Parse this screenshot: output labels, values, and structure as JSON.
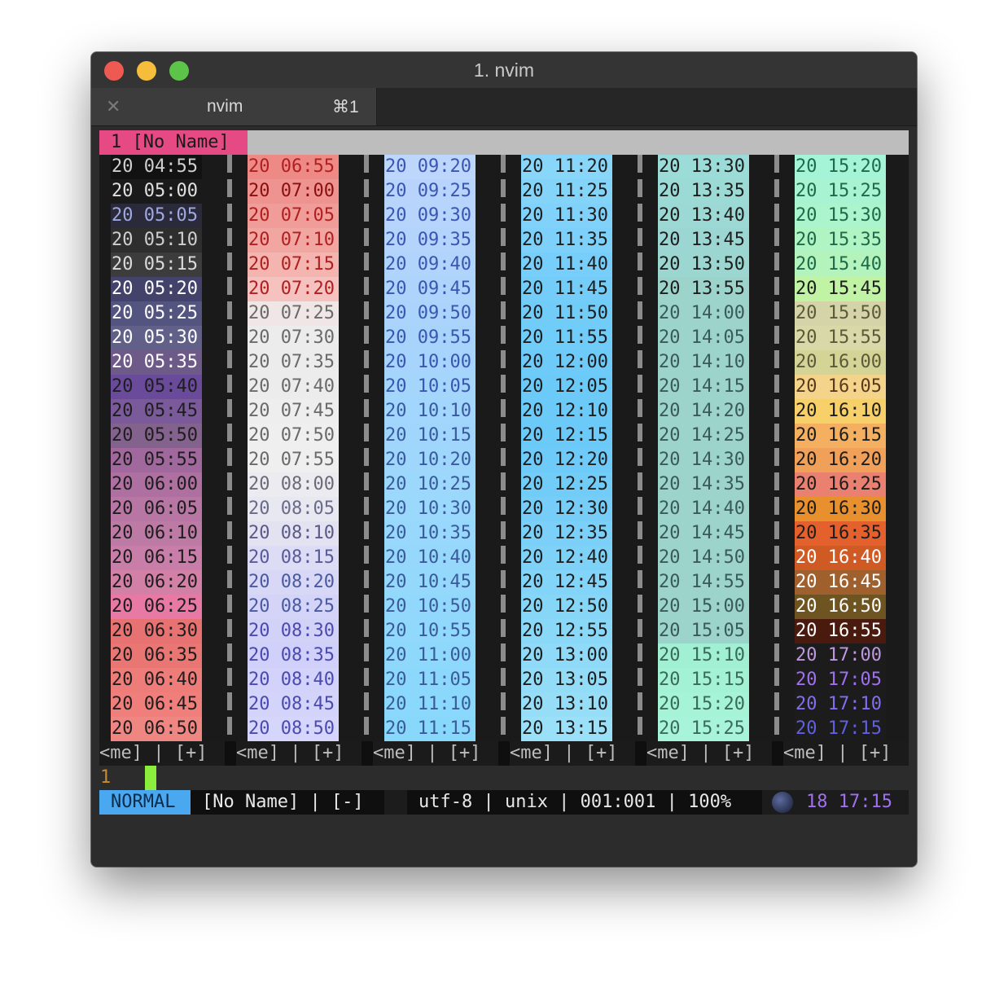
{
  "window": {
    "title": "1. nvim"
  },
  "tab": {
    "name": "nvim",
    "shortcut": "⌘1"
  },
  "tabline": {
    "current": "1 [No Name]"
  },
  "columns": [
    {
      "times": [
        "20 04:55",
        "20 05:00",
        "20 05:05",
        "20 05:10",
        "20 05:15",
        "20 05:20",
        "20 05:25",
        "20 05:30",
        "20 05:35",
        "20 05:40",
        "20 05:45",
        "20 05:50",
        "20 05:55",
        "20 06:00",
        "20 06:05",
        "20 06:10",
        "20 06:15",
        "20 06:20",
        "20 06:25",
        "20 06:30",
        "20 06:35",
        "20 06:40",
        "20 06:45",
        "20 06:50"
      ],
      "bg": [
        "#121212",
        "#1a1a1a",
        "#2a2a3a",
        "#2e2e2e",
        "#3c3c3c",
        "#42426a",
        "#545480",
        "#606088",
        "#6e5a88",
        "#6a4a9a",
        "#7a5a9a",
        "#84628e",
        "#a0689c",
        "#ae70a0",
        "#b876a4",
        "#bc7aa4",
        "#c87ea8",
        "#d280a6",
        "#e878a4",
        "#e87272",
        "#ea7674",
        "#ee7c78",
        "#f07e7a",
        "#f08682"
      ],
      "fg": [
        "#cfcfcf",
        "#e0e0e0",
        "#a0a8e0",
        "#cfcfcf",
        "#dadada",
        "#ffffff",
        "#ffffff",
        "#ffffff",
        "#ffffff",
        "#1e1e1e",
        "#1e1e1e",
        "#1e1e1e",
        "#1e1e1e",
        "#1e1e1e",
        "#1e1e1e",
        "#1e1e1e",
        "#1e1e1e",
        "#1e1e1e",
        "#1e1e1e",
        "#1e1e1e",
        "#1e1e1e",
        "#1e1e1e",
        "#1e1e1e",
        "#1e1e1e"
      ]
    },
    {
      "times": [
        "20 06:55",
        "20 07:00",
        "20 07:05",
        "20 07:10",
        "20 07:15",
        "20 07:20",
        "20 07:25",
        "20 07:30",
        "20 07:35",
        "20 07:40",
        "20 07:45",
        "20 07:50",
        "20 07:55",
        "20 08:00",
        "20 08:05",
        "20 08:10",
        "20 08:15",
        "20 08:20",
        "20 08:25",
        "20 08:30",
        "20 08:35",
        "20 08:40",
        "20 08:45",
        "20 08:50"
      ],
      "bg": [
        "#ee8a86",
        "#ef9390",
        "#f09c98",
        "#f2a6a2",
        "#f4b4b0",
        "#f6c2c0",
        "#f0e6e6",
        "#ececec",
        "#ececec",
        "#ececec",
        "#eeeeee",
        "#efefef",
        "#efefef",
        "#ececf0",
        "#e8e8f0",
        "#e2e2f0",
        "#dcdcf4",
        "#d8d8f6",
        "#d4d4f8",
        "#d2d2f8",
        "#d0d0fa",
        "#d2d2fa",
        "#d4d4fa",
        "#d6d6fc"
      ],
      "fg": [
        "#b02020",
        "#8a1010",
        "#b02020",
        "#b02020",
        "#b02020",
        "#b02020",
        "#6a6a6a",
        "#6a6a6a",
        "#6a6a6a",
        "#6a6a6a",
        "#6a6a6a",
        "#6a6a6a",
        "#6a6a6a",
        "#6a6a7a",
        "#6a6a8a",
        "#5a5a8a",
        "#5a5a9a",
        "#4a5aa0",
        "#4a5aa0",
        "#4a4ab0",
        "#4a4ab0",
        "#4a4ab0",
        "#4a4ab0",
        "#4a4ab0"
      ]
    },
    {
      "times": [
        "20 09:20",
        "20 09:25",
        "20 09:30",
        "20 09:35",
        "20 09:40",
        "20 09:45",
        "20 09:50",
        "20 09:55",
        "20 10:00",
        "20 10:05",
        "20 10:10",
        "20 10:15",
        "20 10:20",
        "20 10:25",
        "20 10:30",
        "20 10:35",
        "20 10:40",
        "20 10:45",
        "20 10:50",
        "20 10:55",
        "20 11:00",
        "20 11:05",
        "20 11:10",
        "20 11:15"
      ],
      "bg": [
        "#bcd6fc",
        "#b8d4fc",
        "#b6d4fc",
        "#b4d4fc",
        "#b0d4fc",
        "#aed4fc",
        "#aad4fc",
        "#a8d4fc",
        "#a6d4fc",
        "#a4d6fc",
        "#a2d6fc",
        "#a0d6fc",
        "#9ed6fc",
        "#9cd8fc",
        "#9ad8fc",
        "#98d8fc",
        "#96d8fc",
        "#94d8fc",
        "#92d8fc",
        "#90d8fc",
        "#8ed8fc",
        "#8cd8fc",
        "#8ad8fc",
        "#88d8fc"
      ],
      "fg": [
        "#3a56b0",
        "#3a56b0",
        "#3a56b0",
        "#3a56b0",
        "#3a56b0",
        "#3a56b0",
        "#3a56b0",
        "#3a56b0",
        "#3a56b0",
        "#3a56b0",
        "#3a5aa0",
        "#3a5aa0",
        "#3a5aa0",
        "#3a5a9a",
        "#3a5a9a",
        "#3a5a9a",
        "#3a5a9a",
        "#3a5a9a",
        "#3a5a9a",
        "#3a5a9a",
        "#3a5a9a",
        "#3a5a9a",
        "#3a5a9a",
        "#3a5a9a"
      ]
    },
    {
      "times": [
        "20 11:20",
        "20 11:25",
        "20 11:30",
        "20 11:35",
        "20 11:40",
        "20 11:45",
        "20 11:50",
        "20 11:55",
        "20 12:00",
        "20 12:05",
        "20 12:10",
        "20 12:15",
        "20 12:20",
        "20 12:25",
        "20 12:30",
        "20 12:35",
        "20 12:40",
        "20 12:45",
        "20 12:50",
        "20 12:55",
        "20 13:00",
        "20 13:05",
        "20 13:10",
        "20 13:15"
      ],
      "bg": [
        "#88d6fa",
        "#84d4fa",
        "#80d2fa",
        "#7cd0fa",
        "#78cefa",
        "#74ccf8",
        "#72ccf8",
        "#70ccf8",
        "#6ecaf8",
        "#6ccaf8",
        "#6ccaf8",
        "#6ccaf8",
        "#6ecaf8",
        "#72ccf8",
        "#76cef8",
        "#7ad0f8",
        "#7ed2f8",
        "#82d4f8",
        "#86d6f8",
        "#8ad8f8",
        "#8edaf8",
        "#92dcf8",
        "#96def8",
        "#9ae0f8"
      ],
      "fg": [
        "#1e1e1e",
        "#1e1e1e",
        "#1e1e1e",
        "#1e1e1e",
        "#1e1e1e",
        "#1e1e1e",
        "#1e1e1e",
        "#1e1e1e",
        "#1e1e1e",
        "#1e1e1e",
        "#1e1e1e",
        "#1e1e1e",
        "#1e1e1e",
        "#1e1e1e",
        "#1e1e1e",
        "#1e1e1e",
        "#1e1e1e",
        "#1e1e1e",
        "#1e1e1e",
        "#1e1e1e",
        "#1e1e1e",
        "#1e1e1e",
        "#1e1e1e",
        "#1e1e1e"
      ]
    },
    {
      "times": [
        "20 13:30",
        "20 13:35",
        "20 13:40",
        "20 13:45",
        "20 13:50",
        "20 13:55",
        "20 14:00",
        "20 14:05",
        "20 14:10",
        "20 14:15",
        "20 14:20",
        "20 14:25",
        "20 14:30",
        "20 14:35",
        "20 14:40",
        "20 14:45",
        "20 14:50",
        "20 14:55",
        "20 15:00",
        "20 15:05",
        "20 15:10",
        "20 15:15",
        "20 15:20",
        "20 15:25"
      ],
      "bg": [
        "#9cdcd8",
        "#9cdad6",
        "#9cd8d4",
        "#9cd6d2",
        "#9cd6d0",
        "#9cd4cc",
        "#9cd4cc",
        "#9cd4cc",
        "#9cd4cc",
        "#9cd4cc",
        "#9cd4cc",
        "#9cd4cc",
        "#9cd4cc",
        "#9cd4cc",
        "#9cd4cc",
        "#9cd4cc",
        "#9cd4cc",
        "#9cd4cc",
        "#9cd4cc",
        "#9cd4cc",
        "#a2f0d4",
        "#a4f2d6",
        "#a6f4d8",
        "#a8f4da"
      ],
      "fg": [
        "#1e1e1e",
        "#1e1e1e",
        "#1e1e1e",
        "#1e1e1e",
        "#1e1e1e",
        "#1e1e1e",
        "#3a5a5a",
        "#3a5a5a",
        "#3a5a5a",
        "#3a5a5a",
        "#3a5a5a",
        "#3a5a5a",
        "#3a5a5a",
        "#3a5a5a",
        "#3a5a5a",
        "#3a5a5a",
        "#3a5a5a",
        "#3a5a5a",
        "#3a5a5a",
        "#3a5a5a",
        "#3a6a5a",
        "#3a6a5a",
        "#3a6a5a",
        "#3a6a5a"
      ]
    },
    {
      "times": [
        "20 15:20",
        "20 15:25",
        "20 15:30",
        "20 15:35",
        "20 15:40",
        "20 15:45",
        "20 15:50",
        "20 15:55",
        "20 16:00",
        "20 16:05",
        "20 16:10",
        "20 16:15",
        "20 16:20",
        "20 16:25",
        "20 16:30",
        "20 16:35",
        "20 16:40",
        "20 16:45",
        "20 16:50",
        "20 16:55",
        "20 17:00",
        "20 17:05",
        "20 17:10",
        "20 17:15"
      ],
      "bg": [
        "#a6f4d8",
        "#a8f4d2",
        "#acf4cc",
        "#b0f4c4",
        "#b4f4bc",
        "#c0f4a4",
        "#d4d4a8",
        "#d8d8a8",
        "#d4d496",
        "#f4d48a",
        "#f8d06a",
        "#f4b060",
        "#f0a058",
        "#ea8070",
        "#e8902e",
        "#e4602c",
        "#d05a24",
        "#a0602e",
        "#6e5420",
        "#4a1a0e",
        "#1c1c1c",
        "#1c1c1c",
        "#1c1c1c",
        "#1c1c1c"
      ],
      "fg": [
        "#1e6a4a",
        "#1e6a4a",
        "#1e6a4a",
        "#1e6a4a",
        "#1e6a4a",
        "#1e1e1e",
        "#5a5a3a",
        "#5a5a3a",
        "#5a5a3a",
        "#5a3a1e",
        "#1e1e1e",
        "#1e1e1e",
        "#1e1e1e",
        "#1e1e1e",
        "#1e1e1e",
        "#1e1e1e",
        "#ffffff",
        "#ffffff",
        "#ffffff",
        "#ffffff",
        "#c098e0",
        "#a070f0",
        "#8070f0",
        "#6060e0"
      ]
    }
  ],
  "pane_status": "<me] | [+]",
  "command_line": {
    "line_number": "1"
  },
  "airline": {
    "mode": "NORMAL",
    "file": "[No Name] | [-]",
    "info": "utf-8 | unix | 001:001 | 100%",
    "clock": "18 17:15",
    "colors": {
      "mode_bg": "#4aa8f0",
      "mode_fg": "#0c2c4c",
      "file_bg": "#0f0f0f",
      "file_fg": "#e8e8e8",
      "info_bg": "#0f0f0f",
      "info_fg": "#e8e8e8",
      "clock_fg": "#a070f0"
    }
  }
}
